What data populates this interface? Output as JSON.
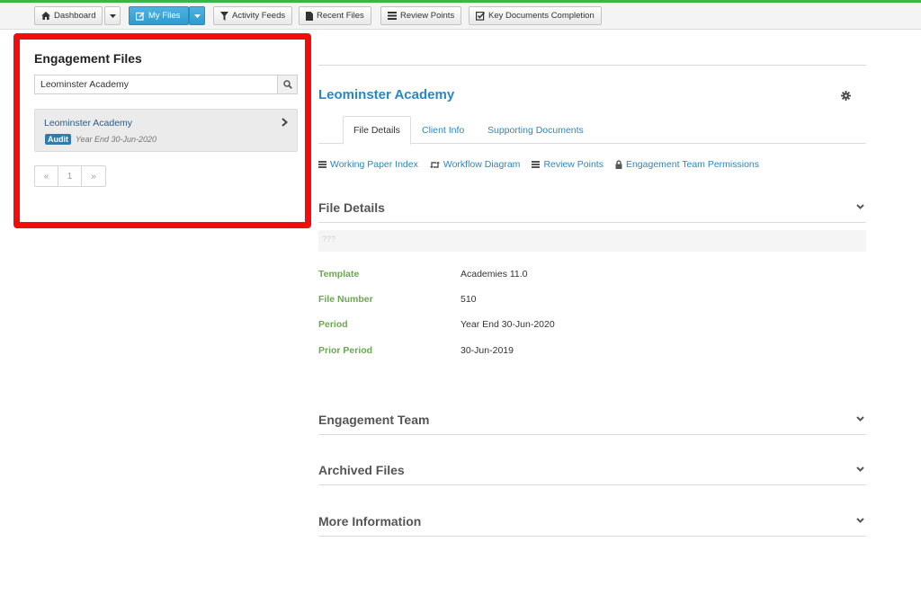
{
  "nav": {
    "buttons": [
      {
        "label": "Dashboard",
        "icon": "home-icon"
      },
      {
        "label": "My Files",
        "icon": "edit-icon"
      },
      {
        "label": "Activity Feeds",
        "icon": "filter-icon"
      },
      {
        "label": "Recent Files",
        "icon": "file-icon"
      },
      {
        "label": "Review Points",
        "icon": "list-icon"
      },
      {
        "label": "Key Documents Completion",
        "icon": "check-square-icon"
      }
    ],
    "accent_color": "#39b54a",
    "primary_color": "#3aa7dd"
  },
  "sidebar": {
    "title": "Engagement Files",
    "search": {
      "value": "Leominster Academy",
      "placeholder": ""
    },
    "results": [
      {
        "name": "Leominster Academy",
        "badge": "Audit",
        "meta": "Year End 30-Jun-2020"
      }
    ],
    "pagination": {
      "prev": "«",
      "current": "1",
      "next": "»"
    },
    "highlight_color": "#f20d0d"
  },
  "main": {
    "title": "Leominster Academy",
    "tabs": [
      {
        "label": "File Details",
        "active": true
      },
      {
        "label": "Client Info",
        "active": false
      },
      {
        "label": "Supporting Documents",
        "active": false
      }
    ],
    "links": [
      {
        "label": "Working Paper Index",
        "icon": "list-icon"
      },
      {
        "label": "Workflow Diagram",
        "icon": "retweet-icon"
      },
      {
        "label": "Review Points",
        "icon": "list-icon"
      },
      {
        "label": "Engagement Team Permissions",
        "icon": "lock-icon"
      }
    ],
    "file_details": {
      "title": "File Details",
      "note": "???",
      "fields": [
        {
          "label": "Template",
          "value": "Academies 11.0"
        },
        {
          "label": "File Number",
          "value": "510"
        },
        {
          "label": "Period",
          "value": "Year End 30-Jun-2020"
        },
        {
          "label": "Prior Period",
          "value": "30-Jun-2019"
        }
      ]
    },
    "sections": [
      {
        "title": "Engagement Team"
      },
      {
        "title": "Archived Files"
      },
      {
        "title": "More Information"
      }
    ],
    "link_color": "#2a87c5",
    "label_color": "#6aa84f"
  }
}
